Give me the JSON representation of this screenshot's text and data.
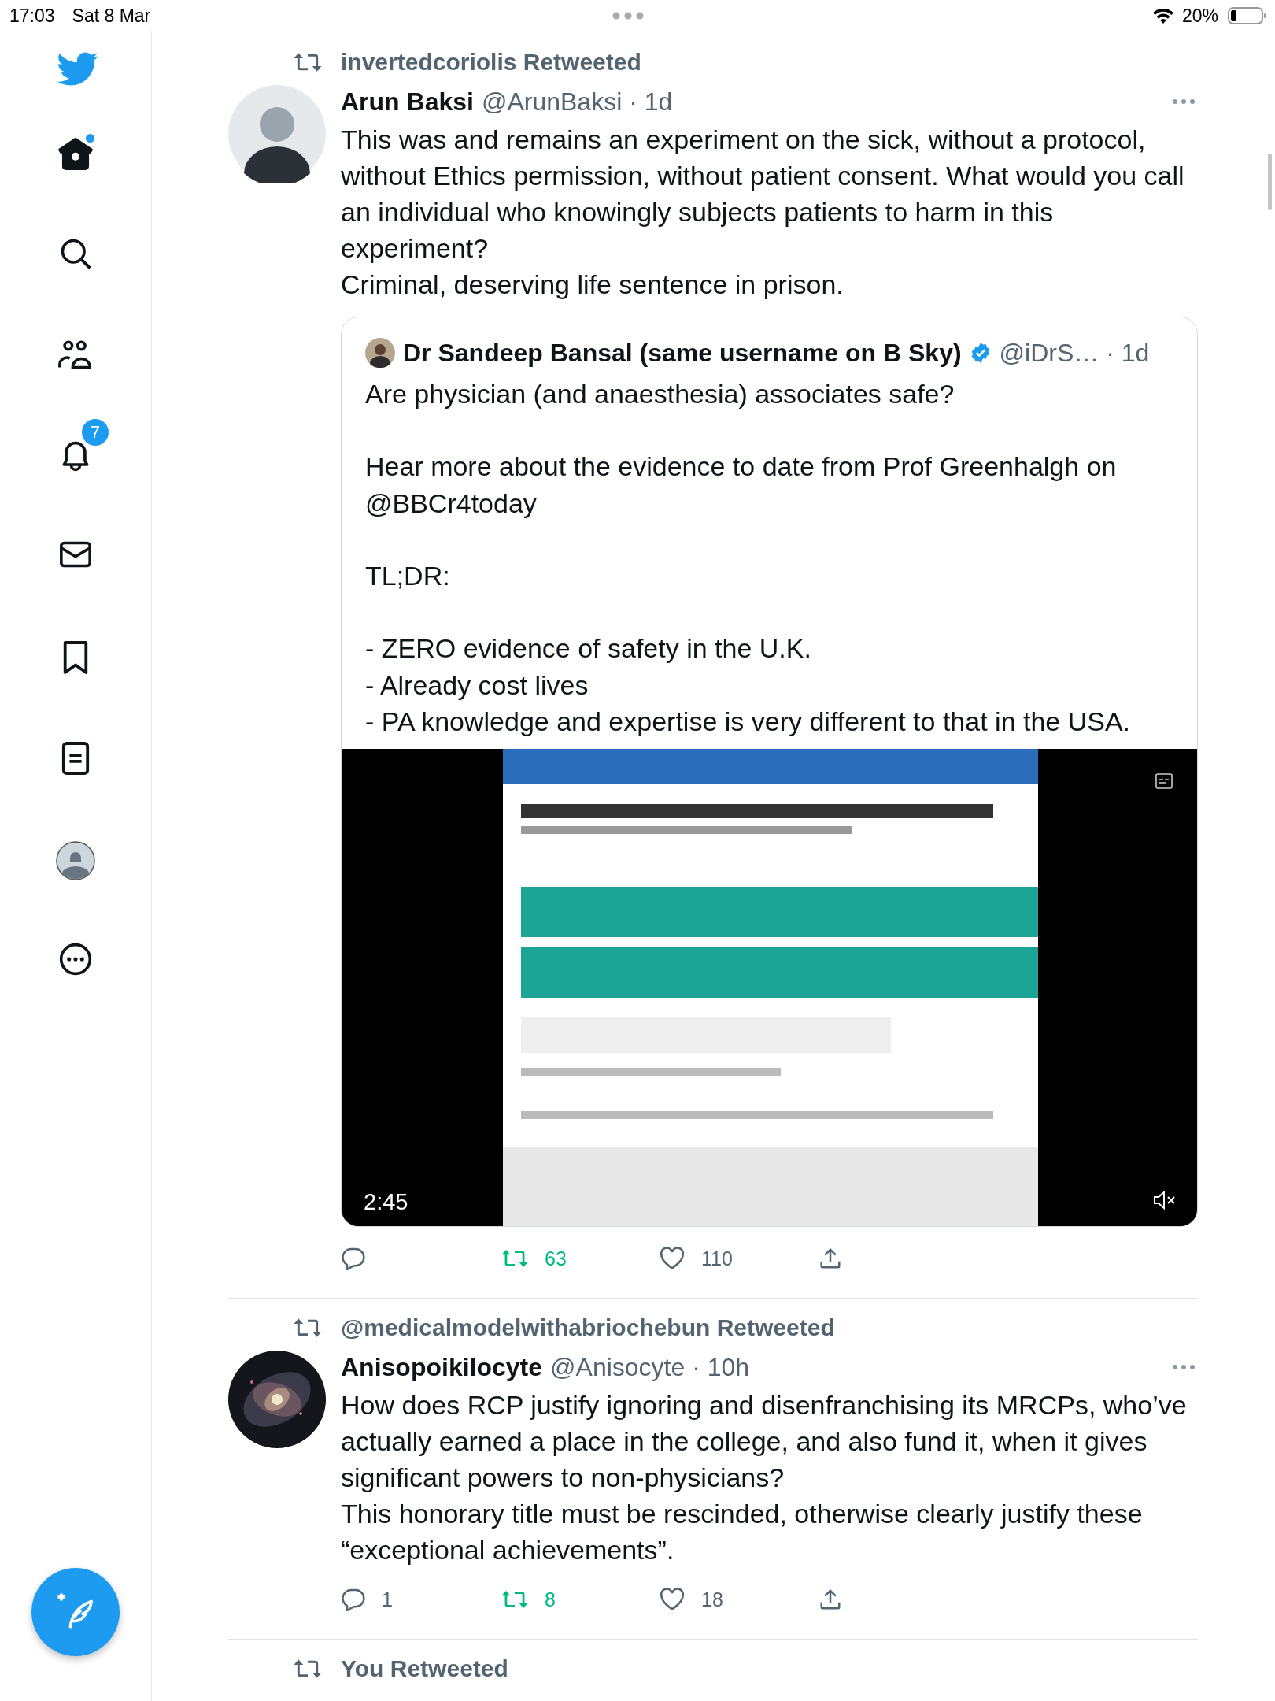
{
  "status_bar": {
    "time": "17:03",
    "date": "Sat 8 Mar",
    "battery": "20%"
  },
  "sidebar": {
    "items": [
      {
        "kind": "home",
        "selected": true,
        "new_dot": true
      },
      {
        "kind": "search",
        "selected": false,
        "new_dot": false
      },
      {
        "kind": "communities",
        "selected": false,
        "new_dot": false
      },
      {
        "kind": "notifications",
        "selected": false,
        "new_dot": false,
        "badge": "7"
      },
      {
        "kind": "messages",
        "selected": false,
        "new_dot": false
      },
      {
        "kind": "bookmarks",
        "selected": false,
        "new_dot": false
      },
      {
        "kind": "lists",
        "selected": false,
        "new_dot": false
      },
      {
        "kind": "profile",
        "selected": false,
        "new_dot": false
      },
      {
        "kind": "more",
        "selected": false,
        "new_dot": false
      }
    ]
  },
  "tweets": [
    {
      "retweeted_by": "invertedcoriolis Retweeted",
      "avatar": {
        "kind": "person"
      },
      "name": "Arun Baksi",
      "meta": "@ArunBaksi · 1d",
      "text": "This was and remains an experiment on the sick, without a protocol, without Ethics permission, without  patient consent. What would you call an individual who knowingly subjects patients to harm in this experiment?\nCriminal, deserving life sentence in prison.",
      "quote": {
        "name": "Dr Sandeep Bansal (same username on B Sky)",
        "verified": true,
        "meta": "@iDrS… · 1d",
        "text": "Are physician (and anaesthesia) associates safe?\n\nHear more about the evidence to date from Prof Greenhalgh on @BBCr4today\n\nTL;DR:\n\n- ZERO evidence of safety in the U.K.\n- Already cost lives\n- PA knowledge and expertise is very different to that in the USA.",
        "video": {
          "kind": "picture",
          "duration": "2:45",
          "muted": true
        }
      },
      "actions": {
        "retweets": "63",
        "retweeted": true,
        "likes": "110",
        "liked": false
      }
    },
    {
      "retweeted_by": "@medicalmodelwithabriochebun Retweeted",
      "name": "Anisopoikilocyte",
      "meta": "@Anisocyte · 10h",
      "text": "How does RCP justify ignoring and disenfranchising its MRCPs, who’ve actually earned a place in the college, and also fund it, when it gives significant powers to non-physicians?\nThis honorary title must be rescinded, otherwise clearly justify these “exceptional achievements”.",
      "actions": {
        "replies": "1",
        "retweets": "8",
        "retweeted": true,
        "likes": "18",
        "liked": false
      }
    },
    {
      "retweeted_by": "You Retweeted"
    }
  ]
}
